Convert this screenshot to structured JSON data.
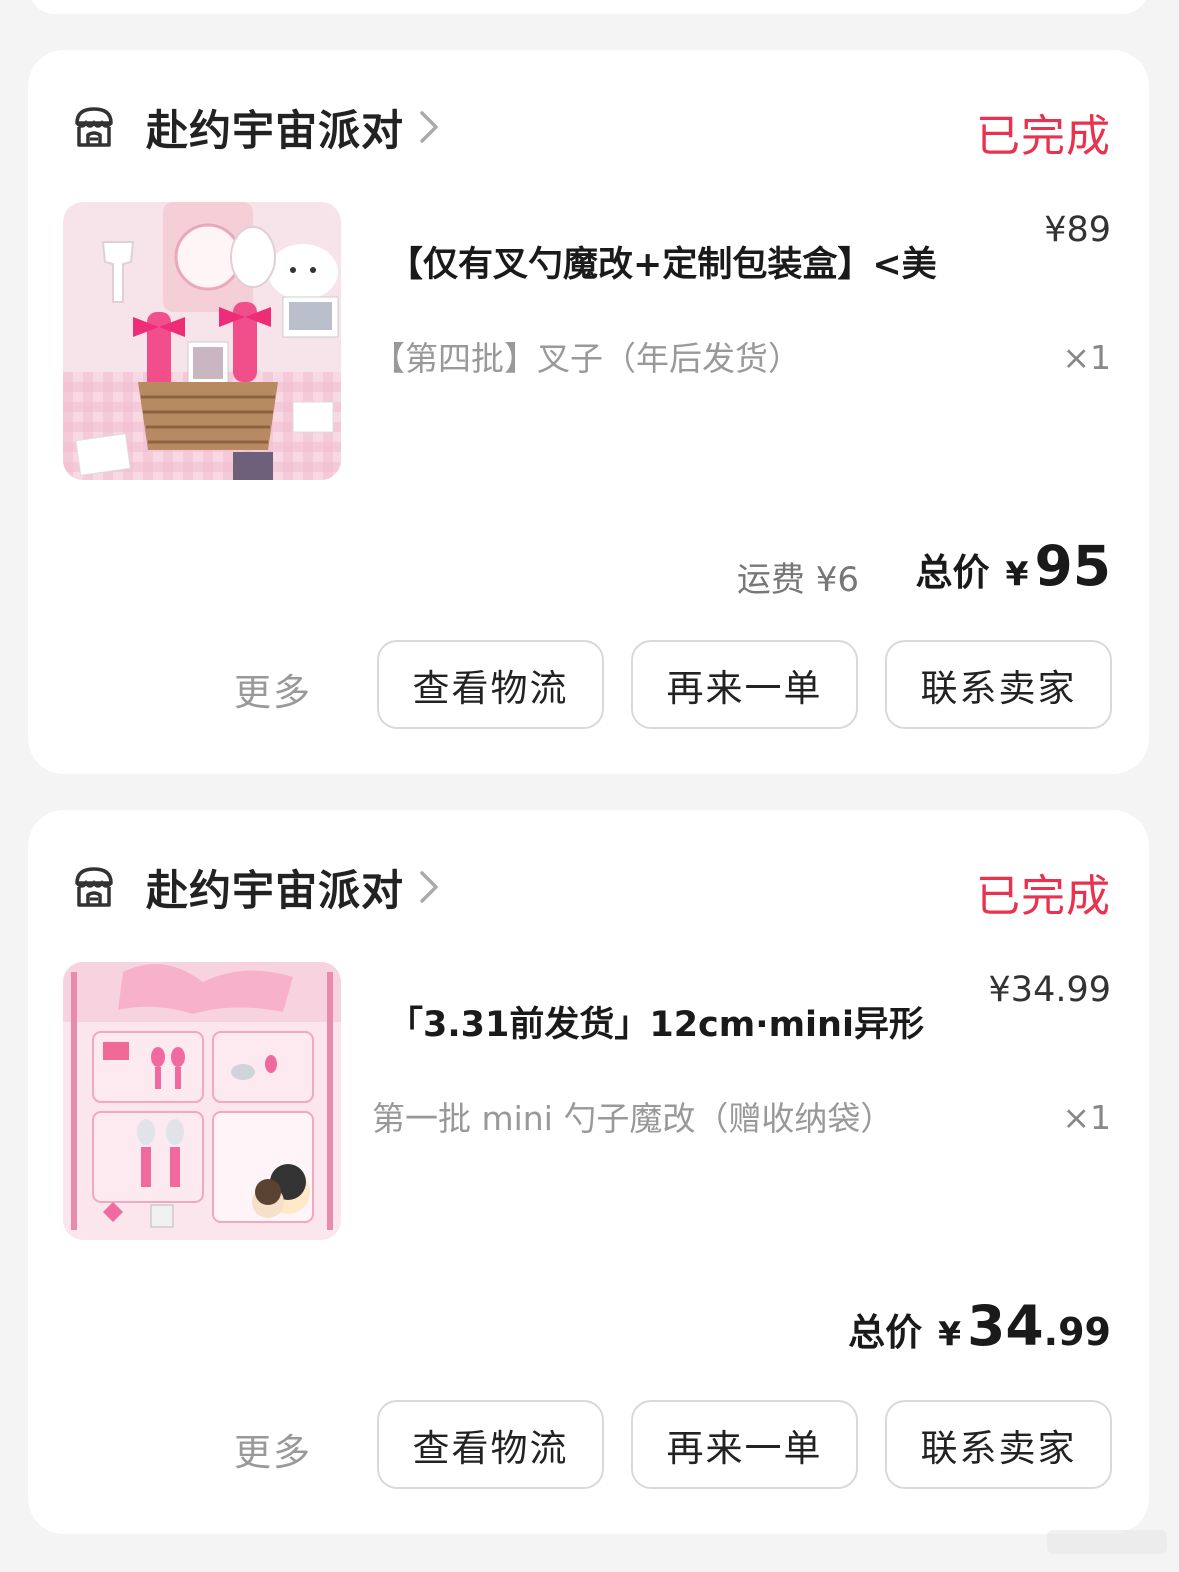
{
  "colors": {
    "accent": "#e8324e",
    "card_bg": "#ffffff",
    "page_bg": "#f4f4f4"
  },
  "orders": [
    {
      "shop_name": "赴约宇宙派对",
      "status": "已完成",
      "title": "【仅有叉勺魔改+定制包装盒】<美",
      "price": "¥89",
      "spec": "【第四批】叉子（年后发货）",
      "quantity": "×1",
      "shipping": "运费 ¥6",
      "total_label": "总价",
      "total_currency": "¥",
      "total_int": "95",
      "total_dec": "",
      "more_label": "更多",
      "buttons": [
        "查看物流",
        "再来一单",
        "联系卖家"
      ]
    },
    {
      "shop_name": "赴约宇宙派对",
      "status": "已完成",
      "title": "「3.31前发货」12cm·mini异形",
      "price": "¥34.99",
      "spec": "第一批 mini 勺子魔改（赠收纳袋）",
      "quantity": "×1",
      "total_label": "总价",
      "total_currency": "¥",
      "total_int": "34",
      "total_dec": ".99",
      "more_label": "更多",
      "buttons": [
        "查看物流",
        "再来一单",
        "联系卖家"
      ]
    }
  ]
}
